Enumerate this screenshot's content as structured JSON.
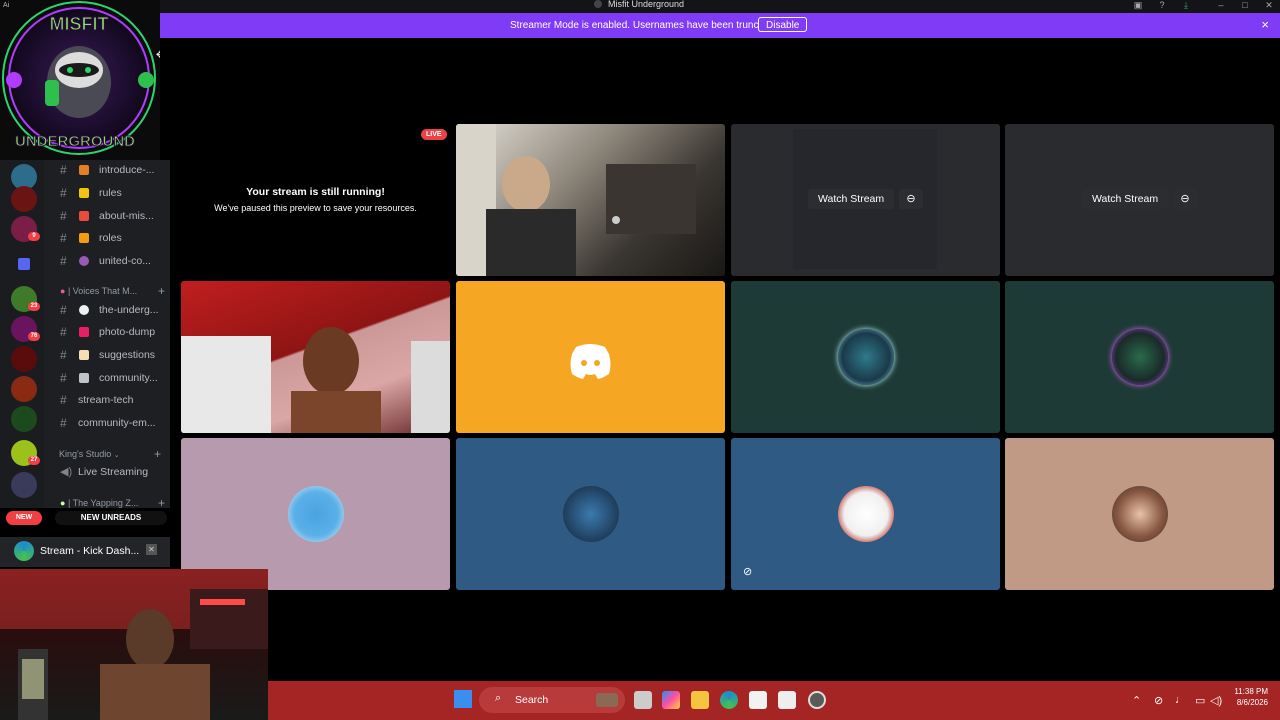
{
  "window": {
    "title": "Misfit Underground"
  },
  "banner": {
    "message": "Streamer Mode is enabled. Usernames have been truncated.",
    "disable_label": "Disable",
    "close_icon": "×"
  },
  "server_logo": {
    "top_word": "MISFIT",
    "bottom_word": "UNDERGROUND",
    "corner_label": "Ai"
  },
  "server_rail": {
    "badges": [
      "9",
      "23",
      "76",
      "27"
    ],
    "new_label": "NEW"
  },
  "channels": {
    "items": [
      {
        "label": "introduce-...",
        "emoji_color": "#e67e22"
      },
      {
        "label": "rules",
        "emoji_color": "#f1c40f"
      },
      {
        "label": "about-mis...",
        "emoji_color": "#e74c3c"
      },
      {
        "label": "roles",
        "emoji_color": "#f39c12"
      },
      {
        "label": "united-co...",
        "emoji_color": "#9b59b6"
      }
    ],
    "category_voices": "| Voices That M...",
    "items2": [
      {
        "label": "the-underg...",
        "emoji_color": "#ecf0f1"
      },
      {
        "label": "photo-dump",
        "emoji_color": "#e91e63"
      },
      {
        "label": "suggestions",
        "emoji_color": "#f5deb3"
      },
      {
        "label": "community...",
        "emoji_color": "#bdc3c7"
      },
      {
        "label": "stream-tech",
        "emoji_color": ""
      },
      {
        "label": "community-em...",
        "emoji_color": ""
      }
    ],
    "category_kings": "King's Studio",
    "voice_channel": "Live Streaming",
    "category_yapping": "| The Yapping Z...",
    "new_unreads": "NEW UNREADS"
  },
  "stream_status": {
    "label": "Stream - Kick Dash..."
  },
  "stage": {
    "live_label": "LIVE",
    "paused_title": "Your stream is still running!",
    "paused_sub": "We've paused this preview to save your resources.",
    "watch_label": "Watch Stream"
  },
  "taskbar": {
    "search_label": "Search",
    "time": "11:38 PM",
    "date": "8/6/2026"
  },
  "colors": {
    "banner": "#7f3bf5",
    "discord_tile": "#f5a623",
    "teal_tile": "#1e3a36",
    "lilac_tile": "#b89aae",
    "blue_tile": "#2e5a83",
    "peach_tile": "#c19a86",
    "taskbar": "#a52424"
  }
}
